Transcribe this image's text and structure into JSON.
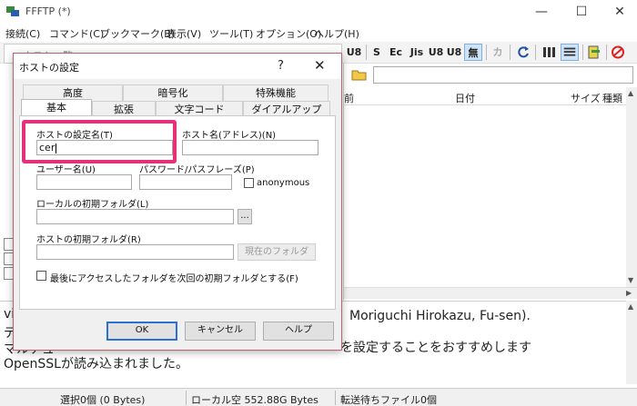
{
  "window": {
    "title": "FFFTP (*)",
    "controls": {
      "minimize": "—",
      "maximize": "☐",
      "close": "✕"
    }
  },
  "menu": [
    "接続(C)",
    "コマンド(C)",
    "ブックマーク(B)",
    "表示(V)",
    "ツール(T)",
    "オプション(O)",
    "ヘルプ(H)"
  ],
  "toolbar": {
    "buttons": [
      "U8",
      "S",
      "Ec",
      "Jis",
      "U8",
      "U8",
      "無",
      "カ"
    ]
  },
  "remote_list": {
    "columns": {
      "name": "前",
      "date": "日付",
      "size": "サイズ",
      "type": "種類"
    }
  },
  "host_list_title": "ホスト一覧",
  "log": {
    "lines": [
      "vit",
      "デ",
      "マルチュ",
      "OpenSSLが読み込まれました。"
    ],
    "right_fragments": [
      "Moriguchi Hirokazu, Fu-sen).",
      "を設定することをおすすめします"
    ]
  },
  "status": {
    "selected": "選択0個 (0 Bytes)",
    "local_free": "ローカル空 552.88G Bytes",
    "queue": "転送待ちファイル0個"
  },
  "dialog": {
    "title": "ホストの設定",
    "help": "?",
    "close": "✕",
    "tabs_back": [
      "高度",
      "暗号化",
      "特殊機能"
    ],
    "tabs_front": [
      "基本",
      "拡張",
      "文字コード",
      "ダイアルアップ"
    ],
    "host_name_label": "ホストの設定名(T)",
    "host_name_value": "cer",
    "host_addr_label": "ホスト名(アドレス)(N)",
    "host_addr_value": "",
    "user_label": "ユーザー名(U)",
    "password_label": "パスワード/パスフレーズ(P)",
    "anonymous_label": "anonymous",
    "local_folder_label": "ローカルの初期フォルダ(L)",
    "browse_label": "...",
    "host_folder_label": "ホストの初期フォルダ(R)",
    "current_folder_button": "現在のフォルダ",
    "last_folder_label": "最後にアクセスしたフォルダを次回の初期フォルダとする(F)",
    "ok": "OK",
    "cancel": "キャンセル",
    "help_button": "ヘルプ"
  },
  "colors": {
    "highlight": "#e6307a",
    "default_button_border": "#2a6fd4"
  }
}
